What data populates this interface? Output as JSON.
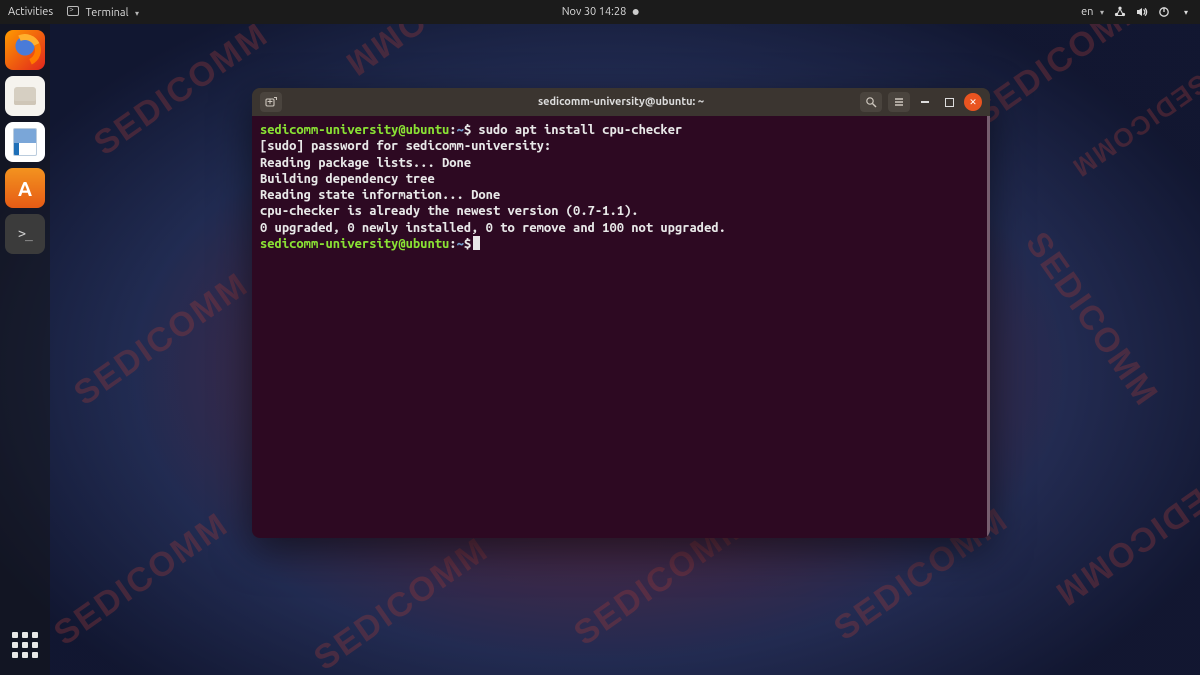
{
  "topbar": {
    "activities": "Activities",
    "app_menu": "Terminal",
    "datetime": "Nov 30  14:28",
    "lang": "en"
  },
  "dock": {
    "firefox": "Firefox",
    "files": "Files",
    "writer": "LibreOffice Writer",
    "software": "Ubuntu Software",
    "terminal": "Terminal",
    "apps": "Show Applications"
  },
  "window": {
    "title": "sedicomm-university@ubuntu: ~"
  },
  "prompt": {
    "user": "sedicomm-university",
    "at": "@",
    "host": "ubuntu",
    "colon": ":",
    "path": "~",
    "sigil": "$"
  },
  "terminal": {
    "command1": "sudo apt install cpu-checker",
    "out1": "[sudo] password for sedicomm-university:",
    "out2": "Reading package lists... Done",
    "out3": "Building dependency tree",
    "out4": "Reading state information... Done",
    "out5": "cpu-checker is already the newest version (0.7-1.1).",
    "out6": "0 upgraded, 0 newly installed, 0 to remove and 100 not upgraded."
  },
  "watermark": "SEDICOMM"
}
